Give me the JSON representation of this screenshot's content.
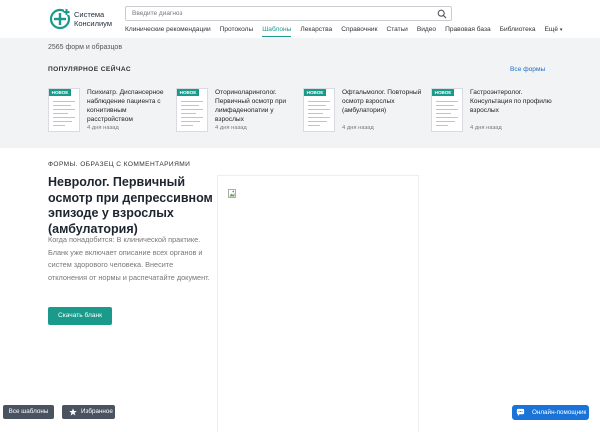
{
  "header": {
    "logo_line1": "Система",
    "logo_line2": "Консилиум",
    "search_placeholder": "Введите диагноз",
    "nav": [
      "Клинические рекомендации",
      "Протоколы",
      "Шаблоны",
      "Лекарства",
      "Справочник",
      "Статьи",
      "Видео",
      "Правовая база",
      "Библиотека",
      "Ещё"
    ],
    "active_nav": "Шаблоны",
    "more_chevron": "chevron-down-icon"
  },
  "summary": {
    "count_text": "2565 форм и образцов"
  },
  "popular": {
    "heading": "ПОПУЛЯРНОЕ СЕЙЧАС",
    "all_link": "Все формы",
    "cards": [
      {
        "badge": "НОВОЕ",
        "title": "Психиатр. Диспансерное наблюдение пациента с когнитивным расстройством",
        "date": "4 дня назад"
      },
      {
        "badge": "НОВОЕ",
        "title": "Оториноларинголог. Первичный осмотр при лимфаденопатии у взрослых",
        "date": "4 дня назад"
      },
      {
        "badge": "НОВОЕ",
        "title": "Офтальмолог. Повторный осмотр взрослых (амбулатория)",
        "date": "4 дня назад"
      },
      {
        "badge": "НОВОЕ",
        "title": "Гастроэнтеролог. Консультация по профилю взрослых",
        "date": "4 дня назад"
      }
    ]
  },
  "main": {
    "section_label": "ФОРМЫ. ОБРАЗЕЦ С КОММЕНТАРИЯМИ",
    "title": "Невролог. Первичный осмотр при депрессивном эпизоде у взрослых (амбулатория)",
    "description": "Когда понадобится: В клинической практике. Бланк уже включает описание всех органов и систем здорового человека. Внесите отклонения от нормы и распечатайте документ.",
    "download_label": "Скачать бланк"
  },
  "bottom": {
    "all_templates": "Все шаблоны",
    "favorites": "Избранное",
    "help": "Онлайн-помощник"
  },
  "colors": {
    "accent": "#1a9a8a",
    "link": "#1a6fc4",
    "dark_button": "#4a5461",
    "help_button": "#1a73d9",
    "band": "#f2f3f5"
  }
}
